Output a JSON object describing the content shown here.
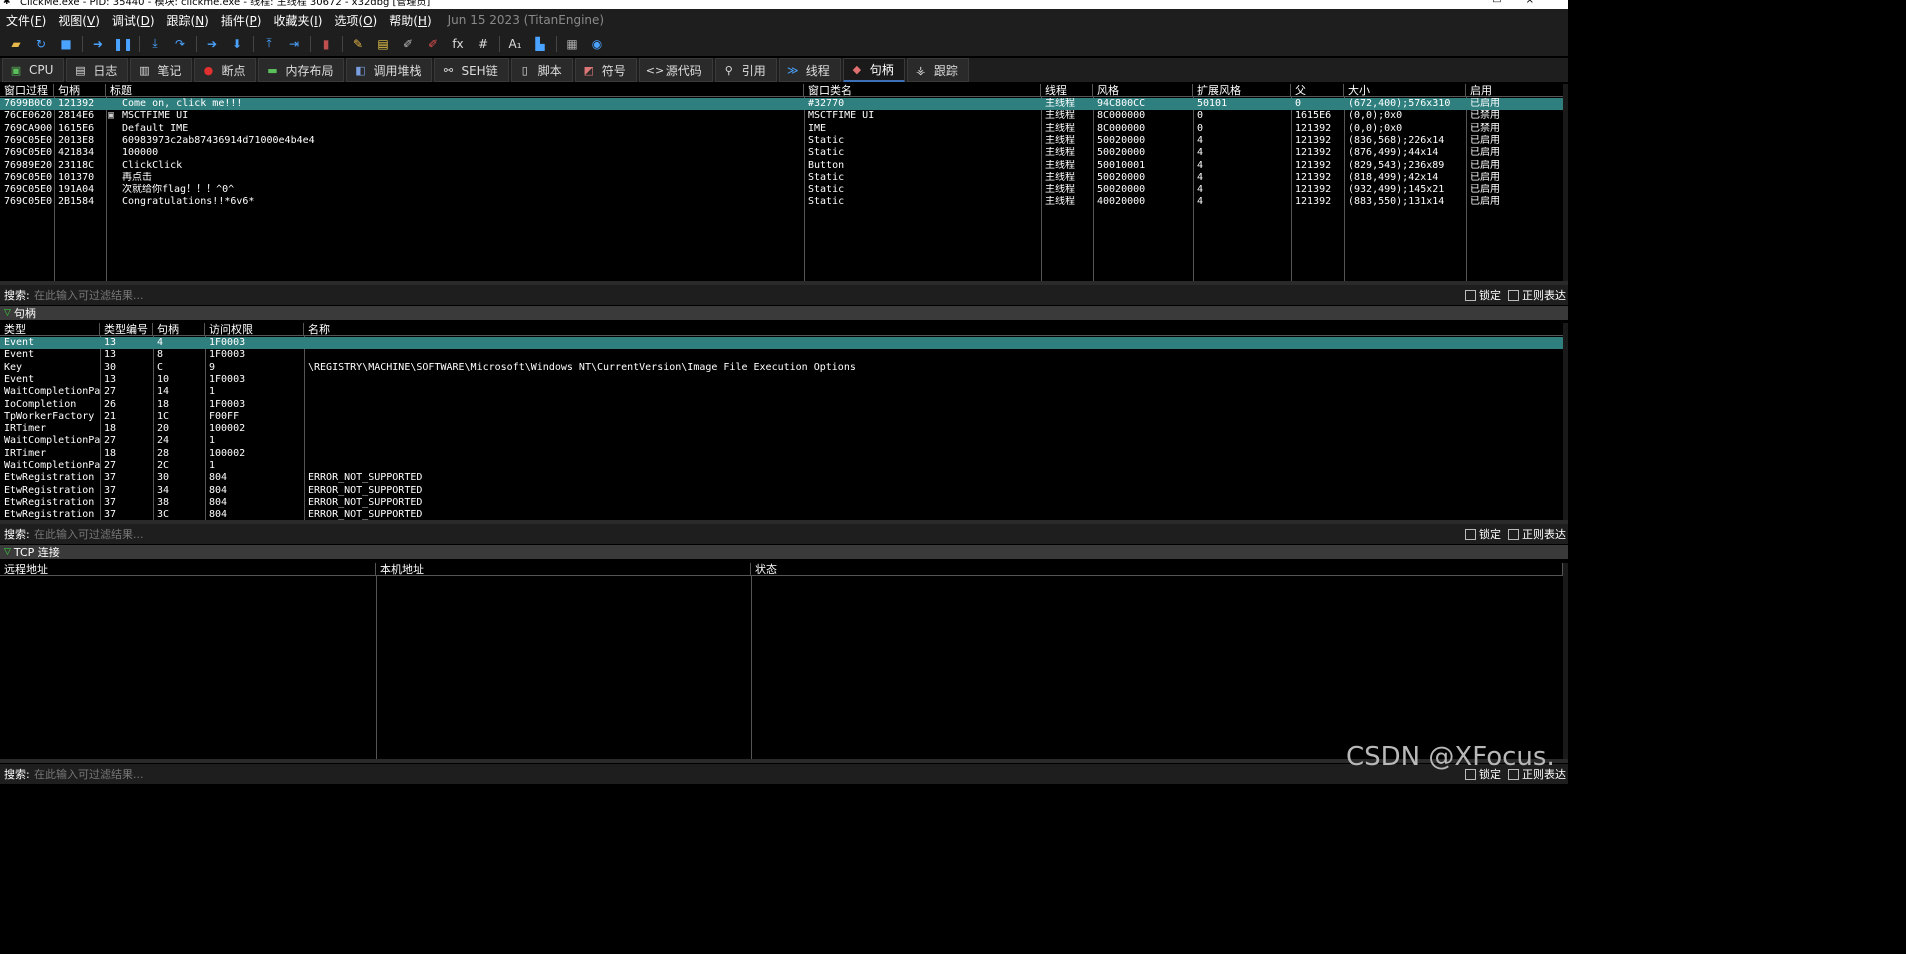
{
  "titlebar": {
    "text": "ClickMe.exe - PID: 35440 - 模块: clickme.exe - 线程: 主线程 30672 - x32dbg [管理员]"
  },
  "menu": [
    {
      "label": "文件(",
      "key": "F",
      "tail": ")"
    },
    {
      "label": "视图(",
      "key": "V",
      "tail": ")"
    },
    {
      "label": "调试(",
      "key": "D",
      "tail": ")"
    },
    {
      "label": "跟踪(",
      "key": "N",
      "tail": ")"
    },
    {
      "label": "插件(",
      "key": "P",
      "tail": ")"
    },
    {
      "label": "收藏夹(",
      "key": "I",
      "tail": ")"
    },
    {
      "label": "选项(",
      "key": "O",
      "tail": ")"
    },
    {
      "label": "帮助(",
      "key": "H",
      "tail": ")"
    }
  ],
  "build_date": "Jun 15 2023 (TitanEngine)",
  "toolbar": [
    {
      "name": "open-icon",
      "glyph": "▰",
      "color": "#e8b84a"
    },
    {
      "name": "restart-icon",
      "glyph": "↻",
      "color": "#4aa3ff"
    },
    {
      "name": "stop-icon",
      "glyph": "■",
      "color": "#4aa3ff"
    },
    {
      "name": "sep"
    },
    {
      "name": "run-icon",
      "glyph": "➜",
      "color": "#4aa3ff"
    },
    {
      "name": "pause-icon",
      "glyph": "❚❚",
      "color": "#4aa3ff"
    },
    {
      "name": "sep"
    },
    {
      "name": "step-into-icon",
      "glyph": "⤓",
      "color": "#4aa3ff"
    },
    {
      "name": "step-over-icon",
      "glyph": "↷",
      "color": "#4aa3ff"
    },
    {
      "name": "sep"
    },
    {
      "name": "trace-into-icon",
      "glyph": "➔",
      "color": "#4aa3ff"
    },
    {
      "name": "trace-over-icon",
      "glyph": "⬇",
      "color": "#4aa3ff"
    },
    {
      "name": "sep"
    },
    {
      "name": "execute-till-return-icon",
      "glyph": "⤒",
      "color": "#4aa3ff"
    },
    {
      "name": "run-to-user-code-icon",
      "glyph": "⇥",
      "color": "#4aa3ff"
    },
    {
      "name": "sep"
    },
    {
      "name": "scylla-icon",
      "glyph": "▮",
      "color": "#c05050"
    },
    {
      "name": "sep"
    },
    {
      "name": "patch-icon",
      "glyph": "✎",
      "color": "#e8b84a"
    },
    {
      "name": "comments-icon",
      "glyph": "▤",
      "color": "#e8c84a"
    },
    {
      "name": "labels-icon",
      "glyph": "✐",
      "color": "#bbbbbb"
    },
    {
      "name": "bookmarks-icon",
      "glyph": "✐",
      "color": "#e05050"
    },
    {
      "name": "functions-icon",
      "glyph": "fx",
      "color": "#dddddd"
    },
    {
      "name": "hash-icon",
      "glyph": "#",
      "color": "#dddddd"
    },
    {
      "name": "sep"
    },
    {
      "name": "strings-icon",
      "glyph": "A₁",
      "color": "#dddddd"
    },
    {
      "name": "document-icon",
      "glyph": "▙",
      "color": "#4aa3ff"
    },
    {
      "name": "sep"
    },
    {
      "name": "calculator-icon",
      "glyph": "▦",
      "color": "#aaaaaa"
    },
    {
      "name": "globe-icon",
      "glyph": "◉",
      "color": "#4aa3ff"
    }
  ],
  "tabs": [
    {
      "name": "tab-cpu",
      "label": "CPU",
      "icon": "▣",
      "icon_color": "#5bbf5b"
    },
    {
      "name": "tab-log",
      "label": "日志",
      "icon": "▤",
      "icon_color": "#dddddd"
    },
    {
      "name": "tab-notes",
      "label": "笔记",
      "icon": "▥",
      "icon_color": "#dddddd"
    },
    {
      "name": "tab-breakpoints",
      "label": "断点",
      "icon": "●",
      "icon_color": "#e03030"
    },
    {
      "name": "tab-memory-map",
      "label": "内存布局",
      "icon": "▬",
      "icon_color": "#5bbf5b"
    },
    {
      "name": "tab-call-stack",
      "label": "调用堆栈",
      "icon": "◧",
      "icon_color": "#7a9fe0"
    },
    {
      "name": "tab-seh-chain",
      "label": "SEH链",
      "icon": "⚯",
      "icon_color": "#dddddd"
    },
    {
      "name": "tab-script",
      "label": "脚本",
      "icon": "▯",
      "icon_color": "#dddddd"
    },
    {
      "name": "tab-symbols",
      "label": "符号",
      "icon": "◩",
      "icon_color": "#dd7777"
    },
    {
      "name": "tab-source",
      "label": "源代码",
      "icon": "<>",
      "icon_color": "#dddddd"
    },
    {
      "name": "tab-references",
      "label": "引用",
      "icon": "⚲",
      "icon_color": "#dddddd"
    },
    {
      "name": "tab-threads",
      "label": "线程",
      "icon": "≫",
      "icon_color": "#4aa3ff"
    },
    {
      "name": "tab-handles",
      "label": "句柄",
      "icon": "◆",
      "icon_color": "#e07070",
      "active": true
    },
    {
      "name": "tab-trace",
      "label": "跟踪",
      "icon": "⚶",
      "icon_color": "#dddddd"
    }
  ],
  "windows": {
    "columns": [
      "窗口过程",
      "句柄",
      "标题",
      "窗口类名",
      "线程",
      "风格",
      "扩展风格",
      "父",
      "大小",
      "启用"
    ],
    "rows": [
      [
        "7699B0C0",
        "121392",
        "Come on, click me!!!",
        "#32770",
        "主线程",
        "94C800CC",
        "50101",
        "0",
        "(672,400);576x310",
        "已启用"
      ],
      [
        "76CE0620",
        "2814E6",
        "MSCTFIME UI",
        "MSCTFIME UI",
        "主线程",
        "8C000000",
        "0",
        "1615E6",
        "(0,0);0x0",
        "已禁用"
      ],
      [
        "769CA900",
        "1615E6",
        "Default IME",
        "IME",
        "主线程",
        "8C000000",
        "0",
        "121392",
        "(0,0);0x0",
        "已禁用"
      ],
      [
        "769C05E0",
        "2013E8",
        "60983973c2ab87436914d71000e4b4e4",
        "Static",
        "主线程",
        "50020000",
        "4",
        "121392",
        "(836,568);226x14",
        "已启用"
      ],
      [
        "769C05E0",
        "421834",
        "100000",
        "Static",
        "主线程",
        "50020000",
        "4",
        "121392",
        "(876,499);44x14",
        "已启用"
      ],
      [
        "76989E20",
        "23118C",
        "ClickClick",
        "Button",
        "主线程",
        "50010001",
        "4",
        "121392",
        "(829,543);236x89",
        "已启用"
      ],
      [
        "769C05E0",
        "101370",
        "再点击",
        "Static",
        "主线程",
        "50020000",
        "4",
        "121392",
        "(818,499);42x14",
        "已启用"
      ],
      [
        "769C05E0",
        "191A04",
        "次就给你flag！！！^0^",
        "Static",
        "主线程",
        "50020000",
        "4",
        "121392",
        "(932,499);145x21",
        "已启用"
      ],
      [
        "769C05E0",
        "2B1584",
        "Congratulations!!*6v6*",
        "Static",
        "主线程",
        "40020000",
        "4",
        "121392",
        "(883,550);131x14",
        "已启用"
      ]
    ]
  },
  "search": {
    "label": "搜索:",
    "placeholder": "在此输入可过滤结果...",
    "lock": "锁定",
    "regex": "正则表达"
  },
  "handles_section": {
    "title": "句柄"
  },
  "handles": {
    "columns": [
      "类型",
      "类型编号",
      "句柄",
      "访问权限",
      "名称"
    ],
    "rows": [
      [
        "Event",
        "13",
        "4",
        "1F0003",
        ""
      ],
      [
        "Event",
        "13",
        "8",
        "1F0003",
        ""
      ],
      [
        "Key",
        "30",
        "C",
        "9",
        "\\REGISTRY\\MACHINE\\SOFTWARE\\Microsoft\\Windows NT\\CurrentVersion\\Image File Execution Options"
      ],
      [
        "Event",
        "13",
        "10",
        "1F0003",
        ""
      ],
      [
        "WaitCompletionPacket",
        "27",
        "14",
        "1",
        ""
      ],
      [
        "IoCompletion",
        "26",
        "18",
        "1F0003",
        ""
      ],
      [
        "TpWorkerFactory",
        "21",
        "1C",
        "F00FF",
        ""
      ],
      [
        "IRTimer",
        "18",
        "20",
        "100002",
        ""
      ],
      [
        "WaitCompletionPacket",
        "27",
        "24",
        "1",
        ""
      ],
      [
        "IRTimer",
        "18",
        "28",
        "100002",
        ""
      ],
      [
        "WaitCompletionPacket",
        "27",
        "2C",
        "1",
        ""
      ],
      [
        "EtwRegistration",
        "37",
        "30",
        "804",
        "ERROR_NOT_SUPPORTED"
      ],
      [
        "EtwRegistration",
        "37",
        "34",
        "804",
        "ERROR_NOT_SUPPORTED"
      ],
      [
        "EtwRegistration",
        "37",
        "38",
        "804",
        "ERROR_NOT_SUPPORTED"
      ],
      [
        "EtwRegistration",
        "37",
        "3C",
        "804",
        "ERROR_NOT_SUPPORTED"
      ]
    ]
  },
  "tcp_section": {
    "title": "TCP 连接"
  },
  "tcp": {
    "columns": [
      "远程地址",
      "本机地址",
      "状态"
    ]
  },
  "watermark": "CSDN @XFocus."
}
